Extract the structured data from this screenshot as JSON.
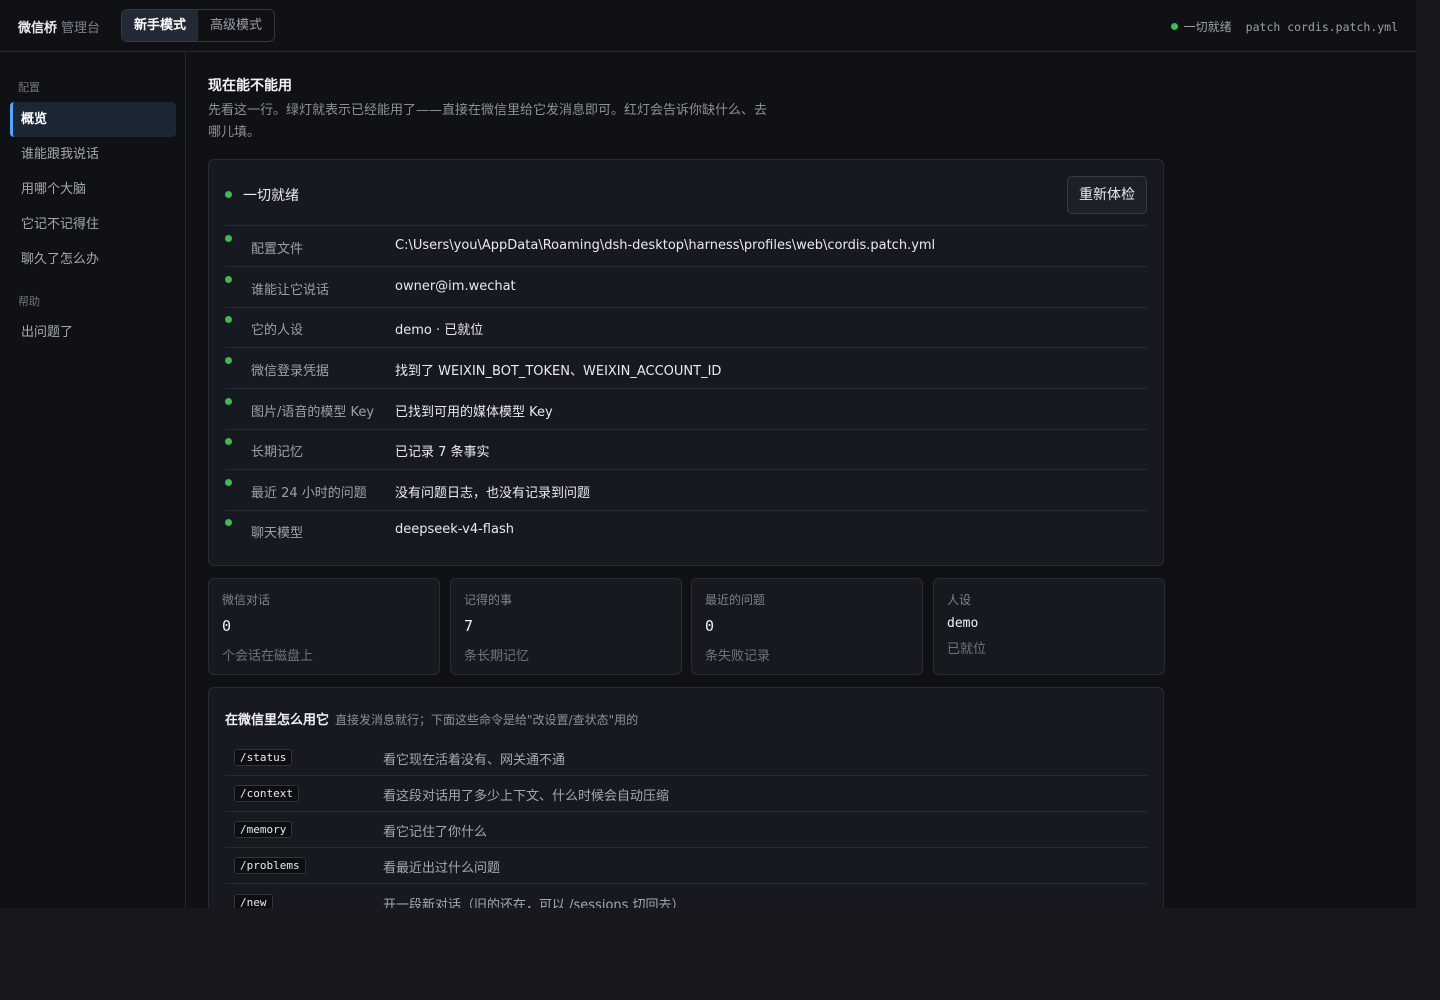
{
  "app": {
    "name": "微信桥",
    "subtitle": "管理台"
  },
  "modes": [
    "新手模式",
    "高级模式"
  ],
  "top_status": {
    "text": "一切就绪",
    "patch": "patch cordis.patch.yml",
    "color": "#3fb950"
  },
  "sidebar": {
    "groups": [
      {
        "label": "配置",
        "items": [
          "概览",
          "谁能跟我说话",
          "用哪个大脑",
          "它记不记得住",
          "聊久了怎么办"
        ]
      },
      {
        "label": "帮助",
        "items": [
          "出问题了"
        ]
      }
    ]
  },
  "page": {
    "title": "现在能不能用",
    "desc": "先看这一行。绿灯就表示已经能用了——直接在微信里给它发消息即可。红灯会告诉你缺什么、去哪儿填。"
  },
  "health": {
    "headline": "一切就绪",
    "recheck_button": "重新体检",
    "rows": [
      {
        "key": "配置文件",
        "value": "C:\\Users\\you\\AppData\\Roaming\\dsh-desktop\\harness\\profiles\\web\\cordis.patch.yml"
      },
      {
        "key": "谁能让它说话",
        "value": "owner@im.wechat"
      },
      {
        "key": "它的人设",
        "value": "demo · 已就位"
      },
      {
        "key": "微信登录凭据",
        "value": "找到了 WEIXIN_BOT_TOKEN、WEIXIN_ACCOUNT_ID"
      },
      {
        "key": "图片/语音的模型 Key",
        "value": "已找到可用的媒体模型 Key"
      },
      {
        "key": "长期记忆",
        "value": "已记录 7 条事实"
      },
      {
        "key": "最近 24 小时的问题",
        "value": "没有问题日志，也没有记录到问题"
      },
      {
        "key": "聊天模型",
        "value": "deepseek-v4-flash"
      }
    ]
  },
  "stats": [
    {
      "label": "微信对话",
      "value": "0",
      "sub": "个会话在磁盘上"
    },
    {
      "label": "记得的事",
      "value": "7",
      "sub": "条长期记忆"
    },
    {
      "label": "最近的问题",
      "value": "0",
      "sub": "条失败记录"
    },
    {
      "label": "人设",
      "value": "demo",
      "sub": "已就位"
    }
  ],
  "commands": {
    "title": "在微信里怎么用它",
    "desc": "直接发消息就行；下面这些命令是给\"改设置/查状态\"用的",
    "rows": [
      {
        "cmd": "/status",
        "desc": "看它现在活着没有、网关通不通"
      },
      {
        "cmd": "/context",
        "desc": "看这段对话用了多少上下文、什么时候会自动压缩"
      },
      {
        "cmd": "/memory",
        "desc": "看它记住了你什么"
      },
      {
        "cmd": "/problems",
        "desc": "看最近出过什么问题"
      },
      {
        "cmd": "/new",
        "desc": "开一段新对话（旧的还在，可以 /sessions 切回去）"
      }
    ]
  }
}
